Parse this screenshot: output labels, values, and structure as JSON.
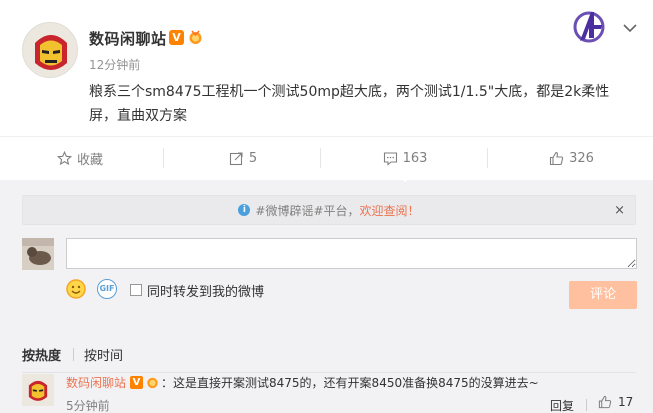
{
  "post": {
    "username": "数码闲聊站",
    "verified_badge": "V",
    "timestamp": "12分钟前",
    "text": "粮系三个sm8475工程机一个测试50mp超大底，两个测试1/1.5\"大底，都是2k柔性屏，直曲双方案"
  },
  "actions": {
    "favorite_label": "收藏",
    "repost_count": "5",
    "comment_count": "163",
    "like_count": "326"
  },
  "notice": {
    "part1": "#微博辟谣#平台，",
    "part2": "欢迎查阅！",
    "close_symbol": "×"
  },
  "composer": {
    "input_value": "",
    "gif_label": "GIF",
    "repost_label": "同时转发到我的微博",
    "submit_label": "评论"
  },
  "sort": {
    "hot_label": "按热度",
    "time_label": "按时间"
  },
  "reply": {
    "username": "数码闲聊站",
    "verified_badge": "V",
    "text": "：这是直接开案测试8475的，还有开案8450准备换8475的没算进去~",
    "timestamp": "5分钟前",
    "report_label": "回复",
    "like_count": "17"
  },
  "colors": {
    "accent_orange": "#ff8200",
    "link_orange": "#eb7350",
    "submit_disabled": "#ffc09f",
    "notice_blue": "#4aa0dd"
  },
  "icons": [
    "iron-man-avatar",
    "verified-v-icon",
    "gold-medal-icon",
    "avengers-logo",
    "chevron-down-icon",
    "star-icon",
    "repost-icon",
    "comment-icon",
    "like-icon",
    "info-icon",
    "close-icon",
    "emoji-icon",
    "gif-icon"
  ]
}
